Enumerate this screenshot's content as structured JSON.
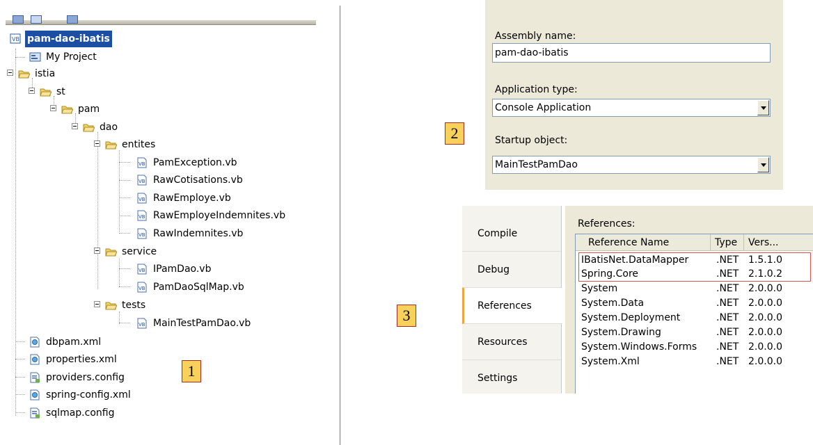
{
  "tree": {
    "root": "pam-dao-ibatis",
    "nodes": {
      "my_project": "My Project",
      "istia": "istia",
      "st": "st",
      "pam": "pam",
      "dao": "dao",
      "entites": "entites",
      "pam_exception": "PamException.vb",
      "raw_cotisations": "RawCotisations.vb",
      "raw_employe": "RawEmploye.vb",
      "raw_employe_indemnites": "RawEmployeIndemnites.vb",
      "raw_indemnites": "RawIndemnites.vb",
      "service": "service",
      "ipamdao": "IPamDao.vb",
      "pamdaosqlmap": "PamDaoSqlMap.vb",
      "tests": "tests",
      "maintest": "MainTestPamDao.vb",
      "dbpam": "dbpam.xml",
      "properties": "properties.xml",
      "providers": "providers.config",
      "spring_config": "spring-config.xml",
      "sqlmap": "sqlmap.config"
    }
  },
  "callouts": {
    "one": "1",
    "two": "2",
    "three": "3"
  },
  "application": {
    "assembly_label": "Assembly name:",
    "assembly_value": "pam-dao-ibatis",
    "app_type_label": "Application type:",
    "app_type_value": "Console Application",
    "startup_label": "Startup object:",
    "startup_value": "MainTestPamDao"
  },
  "project_tabs": [
    "Compile",
    "Debug",
    "References",
    "Resources",
    "Settings"
  ],
  "references": {
    "title": "References:",
    "columns": [
      "Reference Name",
      "Type",
      "Vers..."
    ],
    "rows": [
      {
        "name": "IBatisNet.DataMapper",
        "type": ".NET",
        "version": "1.5.1.0"
      },
      {
        "name": "Spring.Core",
        "type": ".NET",
        "version": "2.1.0.2"
      },
      {
        "name": "System",
        "type": ".NET",
        "version": "2.0.0.0"
      },
      {
        "name": "System.Data",
        "type": ".NET",
        "version": "2.0.0.0"
      },
      {
        "name": "System.Deployment",
        "type": ".NET",
        "version": "2.0.0.0"
      },
      {
        "name": "System.Drawing",
        "type": ".NET",
        "version": "2.0.0.0"
      },
      {
        "name": "System.Windows.Forms",
        "type": ".NET",
        "version": "2.0.0.0"
      },
      {
        "name": "System.Xml",
        "type": ".NET",
        "version": "2.0.0.0"
      }
    ]
  },
  "colors": {
    "selection": "#1c4fa3",
    "callout_fill": "#f7d15a",
    "highlight": "#d9534f",
    "panel_bg": "#ece9d8"
  }
}
